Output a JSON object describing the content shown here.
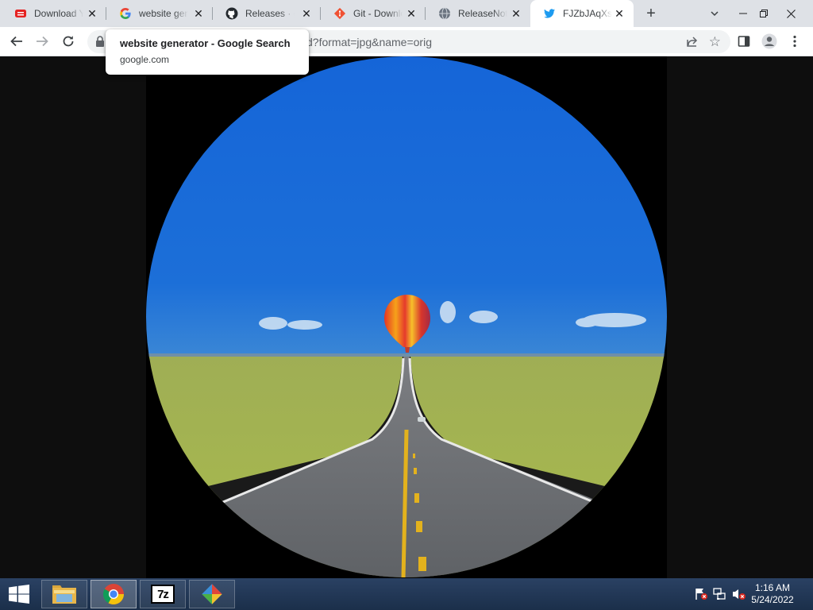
{
  "browser": {
    "tabs": [
      {
        "title": "Download YouTube Videos",
        "favicon": "youtube-download-icon",
        "active": false
      },
      {
        "title": "website generator",
        "favicon": "google-icon",
        "active": false
      },
      {
        "title": "Releases · git",
        "favicon": "github-icon",
        "active": false
      },
      {
        "title": "Git - Downloads",
        "favicon": "git-icon",
        "active": false
      },
      {
        "title": "ReleaseNotes",
        "favicon": "globe-icon",
        "active": false
      },
      {
        "title": "FJZbJAqXsAI",
        "favicon": "twitter-icon",
        "active": true
      }
    ],
    "tab_close_glyph": "✕",
    "new_tab_glyph": "+",
    "address": {
      "url_visible": "d?format=jpg&name=orig"
    },
    "tooltip": {
      "title": "website generator - Google Search",
      "domain": "google.com"
    }
  },
  "image": {
    "description_icon": "hot-air-balloon-road-photo"
  },
  "taskbar": {
    "apps": [
      {
        "name": "file-explorer",
        "icon": "folder-icon"
      },
      {
        "name": "chrome",
        "icon": "chrome-icon"
      },
      {
        "name": "7-zip",
        "icon": "7zip-icon",
        "label": "7z"
      },
      {
        "name": "git-gui",
        "icon": "git-gui-icon"
      }
    ],
    "clock": {
      "time": "1:16 AM",
      "date": "5/24/2022"
    }
  },
  "colors": {
    "tabstrip_bg": "#dee1e6",
    "active_tab_bg": "#ffffff",
    "taskbar_bg": "#1f3552",
    "sky": "#1464d2",
    "grass": "#a7b150",
    "road": "#6f7175",
    "balloon_red": "#e83a2a"
  }
}
